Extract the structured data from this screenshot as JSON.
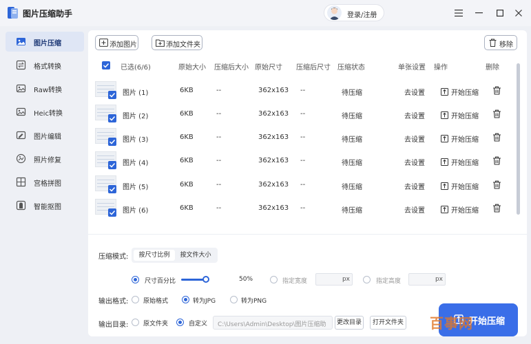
{
  "app": {
    "title": "图片压缩助手"
  },
  "header": {
    "login_label": "登录/注册"
  },
  "window_controls": [
    "menu-icon",
    "minimize-icon",
    "maximize-icon",
    "close-icon"
  ],
  "sidebar": {
    "items": [
      {
        "label": "图片压缩",
        "icon": "image-compress-icon",
        "active": true
      },
      {
        "label": "格式转换",
        "icon": "format-convert-icon",
        "active": false
      },
      {
        "label": "Raw转换",
        "icon": "raw-icon",
        "active": false
      },
      {
        "label": "Heic转换",
        "icon": "heic-icon",
        "active": false
      },
      {
        "label": "图片编辑",
        "icon": "edit-icon",
        "active": false
      },
      {
        "label": "照片修复",
        "icon": "repair-icon",
        "active": false
      },
      {
        "label": "宫格拼图",
        "icon": "grid-icon",
        "active": false
      },
      {
        "label": "智能抠图",
        "icon": "cutout-icon",
        "active": false
      }
    ]
  },
  "toolbar": {
    "add_image": "添加图片",
    "add_folder": "添加文件夹",
    "remove": "移除"
  },
  "table": {
    "headers": {
      "select_all": "已选(6/6)",
      "original_size": "原始大小",
      "compressed_size": "压缩后大小",
      "original_dims": "原始尺寸",
      "compressed_dims": "压缩后尺寸",
      "status": "压缩状态",
      "single_setting": "单张设置",
      "operation": "操作",
      "delete": "删除"
    },
    "rows": [
      {
        "name": "图片 (1)",
        "original_size": "6KB",
        "compressed_size": "--",
        "original_dims": "362x163",
        "compressed_dims": "--",
        "status": "待压缩",
        "setting": "去设置",
        "action": "开始压缩"
      },
      {
        "name": "图片 (2)",
        "original_size": "6KB",
        "compressed_size": "--",
        "original_dims": "362x163",
        "compressed_dims": "--",
        "status": "待压缩",
        "setting": "去设置",
        "action": "开始压缩"
      },
      {
        "name": "图片 (3)",
        "original_size": "6KB",
        "compressed_size": "--",
        "original_dims": "362x163",
        "compressed_dims": "--",
        "status": "待压缩",
        "setting": "去设置",
        "action": "开始压缩"
      },
      {
        "name": "图片 (4)",
        "original_size": "6KB",
        "compressed_size": "--",
        "original_dims": "362x163",
        "compressed_dims": "--",
        "status": "待压缩",
        "setting": "去设置",
        "action": "开始压缩"
      },
      {
        "name": "图片 (5)",
        "original_size": "6KB",
        "compressed_size": "--",
        "original_dims": "362x163",
        "compressed_dims": "--",
        "status": "待压缩",
        "setting": "去设置",
        "action": "开始压缩"
      },
      {
        "name": "图片 (6)",
        "original_size": "6KB",
        "compressed_size": "--",
        "original_dims": "362x163",
        "compressed_dims": "--",
        "status": "待压缩",
        "setting": "去设置",
        "action": "开始压缩"
      }
    ]
  },
  "settings": {
    "mode_label": "压缩模式:",
    "mode_options": [
      "按尺寸比例",
      "按文件大小"
    ],
    "mode_selected": "按尺寸比例",
    "size_percent_label": "尺寸百分比",
    "size_percent_value": "50%",
    "size_percent_fraction": 0.5,
    "width_label": "指定宽度",
    "height_label": "指定高度",
    "px_unit": "px",
    "format_label": "输出格式:",
    "format_options": [
      "原始格式",
      "转为JPG",
      "转为PNG"
    ],
    "format_selected": "转为JPG",
    "dir_label": "输出目录:",
    "dir_options": [
      "原文件夹",
      "自定义"
    ],
    "dir_selected": "自定义",
    "dir_path": "C:\\Users\\Admin\\Desktop\\图片压缩助",
    "change_dir": "更改目录",
    "open_folder": "打开文件夹"
  },
  "start_button": {
    "label": "开始压缩"
  },
  "watermark": {
    "text": "百事网"
  },
  "colors": {
    "accent": "#2d65d8",
    "start_button": "#3a6ee8",
    "active_side": "#dfe6f5"
  }
}
